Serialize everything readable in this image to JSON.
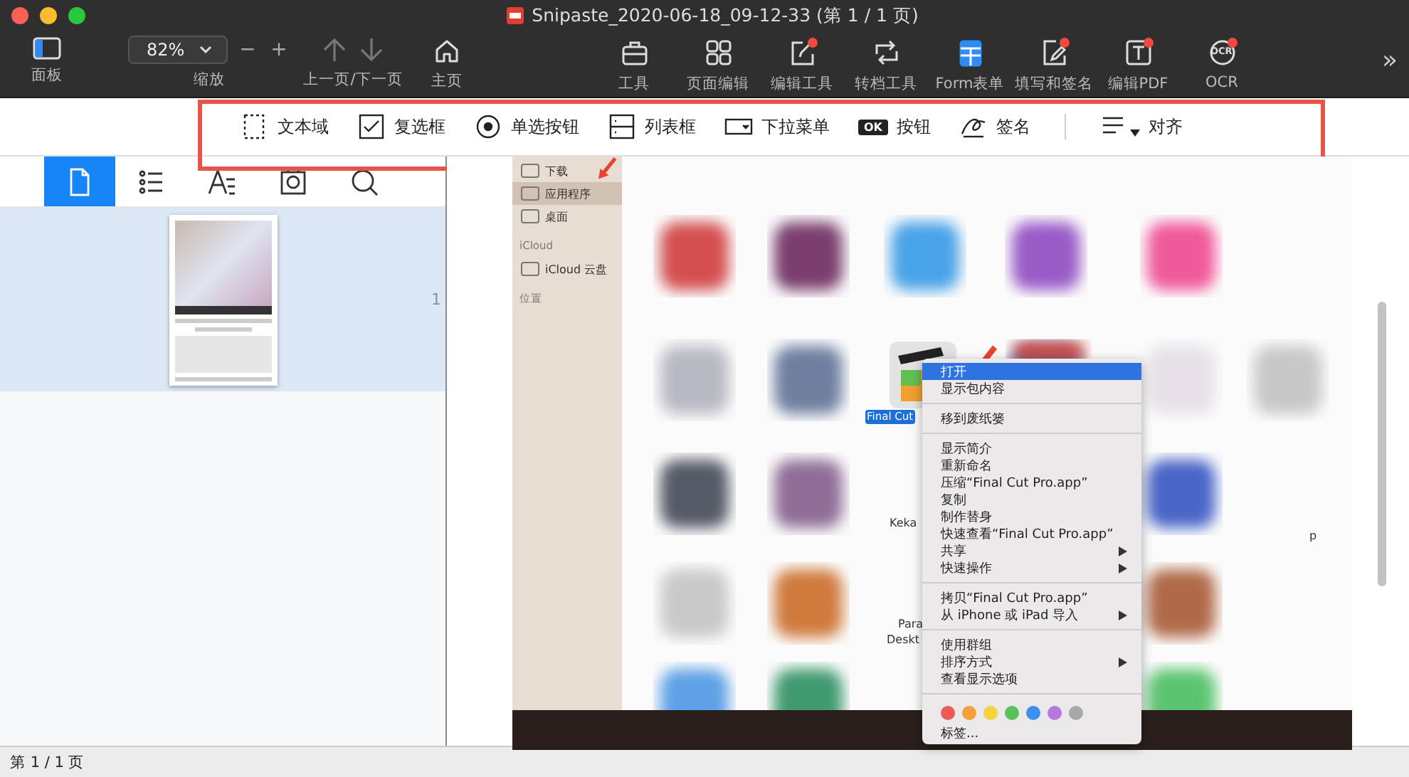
{
  "window": {
    "title": "Snipaste_2020-06-18_09-12-33 (第 1 / 1 页)"
  },
  "toolbar": {
    "panel_label": "面板",
    "zoom": {
      "value": "82%",
      "decrease": "−",
      "increase": "+",
      "label": "缩放"
    },
    "page_nav_label": "上一页/下一页",
    "home_label": "主页",
    "tools": [
      {
        "label": "工具",
        "badge": false,
        "selected": false
      },
      {
        "label": "页面编辑",
        "badge": false,
        "selected": false
      },
      {
        "label": "编辑工具",
        "badge": true,
        "selected": false
      },
      {
        "label": "转档工具",
        "badge": false,
        "selected": false
      },
      {
        "label": "Form表单",
        "badge": false,
        "selected": true
      },
      {
        "label": "填写和签名",
        "badge": true,
        "selected": false
      },
      {
        "label": "编辑PDF",
        "badge": true,
        "selected": false
      },
      {
        "label": "OCR",
        "badge": true,
        "selected": false,
        "icon_text": "OCR"
      }
    ],
    "overflow": "»"
  },
  "form_tools": [
    {
      "label": "文本域",
      "dropdown": false
    },
    {
      "label": "复选框",
      "dropdown": false
    },
    {
      "label": "单选按钮",
      "dropdown": false
    },
    {
      "label": "列表框",
      "dropdown": false
    },
    {
      "label": "下拉菜单",
      "dropdown": false
    },
    {
      "label": "按钮",
      "dropdown": false,
      "icon_text": "OK"
    },
    {
      "label": "签名",
      "dropdown": false
    },
    {
      "label": "对齐",
      "dropdown": true
    }
  ],
  "sidebar": {
    "tabs": [
      {
        "selected": true
      },
      {
        "selected": false
      },
      {
        "selected": false
      },
      {
        "selected": false
      },
      {
        "selected": false
      }
    ],
    "pages": [
      {
        "number": "1",
        "selected": true
      }
    ]
  },
  "document": {
    "finder_sidebar": [
      {
        "kind": "item",
        "label": "下载",
        "selected": false
      },
      {
        "kind": "item",
        "label": "应用程序",
        "selected": true
      },
      {
        "kind": "item",
        "label": "桌面",
        "selected": false
      },
      {
        "kind": "header",
        "label": "iCloud"
      },
      {
        "kind": "item",
        "label": "iCloud 云盘",
        "selected": false
      },
      {
        "kind": "header",
        "label": "位置"
      }
    ],
    "file_labels": [
      {
        "label": "Final Cut",
        "selected": true
      },
      {
        "label": "Keka",
        "selected": false
      },
      {
        "label": "Para",
        "selected": false
      },
      {
        "label": "Deskt",
        "selected": false
      },
      {
        "label": "p",
        "selected": false
      }
    ],
    "context_menu": {
      "groups": [
        [
          {
            "label": "打开",
            "selected": true,
            "submenu": false
          },
          {
            "label": "显示包内容",
            "selected": false,
            "submenu": false
          }
        ],
        [
          {
            "label": "移到废纸篓",
            "selected": false,
            "submenu": false
          }
        ],
        [
          {
            "label": "显示简介",
            "selected": false,
            "submenu": false
          },
          {
            "label": "重新命名",
            "selected": false,
            "submenu": false
          },
          {
            "label": "压缩“Final Cut Pro.app”",
            "selected": false,
            "submenu": false
          },
          {
            "label": "复制",
            "selected": false,
            "submenu": false
          },
          {
            "label": "制作替身",
            "selected": false,
            "submenu": false
          },
          {
            "label": "快速查看“Final Cut Pro.app”",
            "selected": false,
            "submenu": false
          },
          {
            "label": "共享",
            "selected": false,
            "submenu": true
          },
          {
            "label": "快速操作",
            "selected": false,
            "submenu": true
          }
        ],
        [
          {
            "label": "拷贝“Final Cut Pro.app”",
            "selected": false,
            "submenu": false
          },
          {
            "label": "从 iPhone 或 iPad 导入",
            "selected": false,
            "submenu": true
          }
        ],
        [
          {
            "label": "使用群组",
            "selected": false,
            "submenu": false
          },
          {
            "label": "排序方式",
            "selected": false,
            "submenu": true
          },
          {
            "label": "查看显示选项",
            "selected": false,
            "submenu": false
          }
        ]
      ],
      "tag_colors": [
        {
          "color": "#ec5b57"
        },
        {
          "color": "#f4a13b"
        },
        {
          "color": "#f5d33f"
        },
        {
          "color": "#5ac15a"
        },
        {
          "color": "#3f8ff0"
        },
        {
          "color": "#b678de"
        },
        {
          "color": "#a8a8a8"
        }
      ],
      "tags_label": "标签..."
    }
  },
  "status_bar": {
    "page_info": "第 1 / 1 页"
  }
}
